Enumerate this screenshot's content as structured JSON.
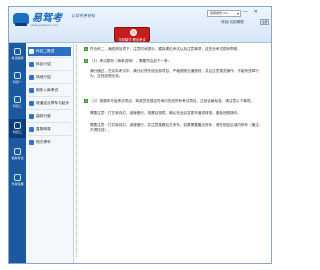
{
  "header": {
    "logo_text": "易驾考",
    "logo_url": "www.yijiakao.com",
    "slogan": "让驾考更轻松",
    "select_value": "选择城市 ALL",
    "window_controls": "— ✕",
    "trial_text": "体验/试用期限",
    "trial_button": "注册",
    "center_button_label": "当前模式·理论考试"
  },
  "nav": {
    "items": [
      {
        "label": "考试指南"
      },
      {
        "label": "科目一"
      },
      {
        "label": "科目二"
      },
      {
        "label": "科目三"
      },
      {
        "label": "模拟考试"
      },
      {
        "label": "驾考宝典"
      }
    ]
  },
  "menu": {
    "items": [
      {
        "label": "科目二概述"
      },
      {
        "label": "科目介绍"
      },
      {
        "label": "场地介绍"
      },
      {
        "label": "倒车入库考试"
      },
      {
        "label": "坡道定点停车与起步"
      },
      {
        "label": "曲线行驶"
      },
      {
        "label": "直角转弯"
      },
      {
        "label": "侧方停车"
      }
    ]
  },
  "content": {
    "p1": "符合科二，满成绩及项下，注意时间提示，模拟理论考试以及注意事项，这些对考试很有帮助。",
    "p2": "（1）考试原则（简单说明），需要符合如下一条：",
    "p3": "满分通过，在实际考试中，满分必须完成全部项目，严格按照交通规则，并且注意规范操作，不能有违章行为，否则成绩无效。",
    "p4": "（2）按顺序开始考试项目，驾驶员在规定时间内完成所有考试项目，达到合格标准，请注意以下事项。",
    "p5": "需要注意：打左转向灯，减速慢行，观察后视镜，确认安全后变更车道或转弯，避免违规操作。",
    "p6": "需要注意：打右转向灯，减速慢行，并注意观察后方来车，如果需要靠边停车，请在规定区域内停车（备注：不得压线）。"
  }
}
